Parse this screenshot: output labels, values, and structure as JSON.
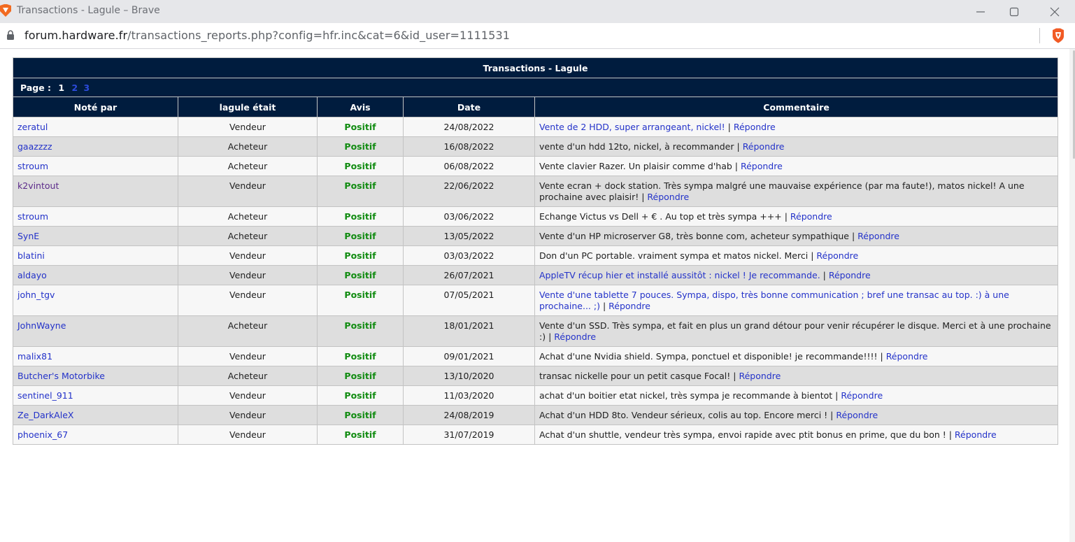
{
  "window": {
    "title": "Transactions - Lagule – Brave"
  },
  "address_bar": {
    "host": "forum.hardware.fr",
    "path": "/transactions_reports.php?config=hfr.inc&cat=6&id_user=1111531"
  },
  "table": {
    "caption": "Transactions - Lagule",
    "pagination": {
      "label": "Page :",
      "current": "1",
      "pages": [
        "2",
        "3"
      ]
    },
    "columns": [
      "Noté par",
      "lagule était",
      "Avis",
      "Date",
      "Commentaire"
    ],
    "reply_label": "Répondre",
    "separator": " | ",
    "rows": [
      {
        "user": "zeratul",
        "role": "Vendeur",
        "avis": "Positif",
        "date": "24/08/2022",
        "comment": "Vente de 2 HDD, super arrangeant, nickel!",
        "comment_is_link": true
      },
      {
        "user": "gaazzzz",
        "role": "Acheteur",
        "avis": "Positif",
        "date": "16/08/2022",
        "comment": "vente d'un hdd 12to, nickel, à recommander",
        "comment_is_link": false
      },
      {
        "user": "stroum",
        "role": "Acheteur",
        "avis": "Positif",
        "date": "06/08/2022",
        "comment": "Vente clavier Razer. Un plaisir comme d'hab",
        "comment_is_link": false
      },
      {
        "user": "k2vintout",
        "role": "Vendeur",
        "avis": "Positif",
        "date": "22/06/2022",
        "comment": "Vente ecran + dock station. Très sympa malgré une mauvaise expérience (par ma faute!), matos nickel! A une prochaine avec plaisir!",
        "comment_is_link": false,
        "visited": true
      },
      {
        "user": "stroum",
        "role": "Acheteur",
        "avis": "Positif",
        "date": "03/06/2022",
        "comment": "Echange Victus vs Dell + € . Au top et très sympa +++",
        "comment_is_link": false
      },
      {
        "user": "SynE",
        "role": "Acheteur",
        "avis": "Positif",
        "date": "13/05/2022",
        "comment": "Vente d'un HP microserver G8, très bonne com, acheteur sympathique",
        "comment_is_link": false
      },
      {
        "user": "blatini",
        "role": "Vendeur",
        "avis": "Positif",
        "date": "03/03/2022",
        "comment": "Don d'un PC portable. vraiment sympa et matos nickel. Merci",
        "comment_is_link": false
      },
      {
        "user": "aldayo",
        "role": "Vendeur",
        "avis": "Positif",
        "date": "26/07/2021",
        "comment": "AppleTV récup hier et installé aussitôt : nickel ! Je recommande.",
        "comment_is_link": true
      },
      {
        "user": "john_tgv",
        "role": "Vendeur",
        "avis": "Positif",
        "date": "07/05/2021",
        "comment": "Vente d'une tablette 7 pouces. Sympa, dispo, très bonne communication ; bref une transac au top. :) à une prochaine... ;)",
        "comment_is_link": true
      },
      {
        "user": "JohnWayne",
        "role": "Acheteur",
        "avis": "Positif",
        "date": "18/01/2021",
        "comment": "Vente d'un SSD. Très sympa, et fait en plus un grand détour pour venir récupérer le disque. Merci et à une prochaine :)",
        "comment_is_link": false
      },
      {
        "user": "malix81",
        "role": "Vendeur",
        "avis": "Positif",
        "date": "09/01/2021",
        "comment": "Achat d'une Nvidia shield. Sympa, ponctuel et disponible! je recommande!!!!",
        "comment_is_link": false
      },
      {
        "user": "Butcher's Motorbike",
        "role": "Acheteur",
        "avis": "Positif",
        "date": "13/10/2020",
        "comment": "transac nickelle pour un petit casque Focal!",
        "comment_is_link": false
      },
      {
        "user": "sentinel_911",
        "role": "Vendeur",
        "avis": "Positif",
        "date": "11/03/2020",
        "comment": "achat d'un boitier etat nickel, très sympa je recommande à bientot",
        "comment_is_link": false
      },
      {
        "user": "Ze_DarkAleX",
        "role": "Vendeur",
        "avis": "Positif",
        "date": "24/08/2019",
        "comment": "Achat d'un HDD 8to. Vendeur sérieux, colis au top. Encore merci !",
        "comment_is_link": false
      },
      {
        "user": "phoenix_67",
        "role": "Vendeur",
        "avis": "Positif",
        "date": "31/07/2019",
        "comment": "Achat d'un shuttle, vendeur très sympa, envoi rapide avec ptit bonus en prime, que du bon !",
        "comment_is_link": false
      }
    ]
  },
  "colors": {
    "header_bg": "#001c3e",
    "link": "#2332c9",
    "positive": "#128c12",
    "row_odd": "#f7f7f7",
    "row_even": "#dedede"
  },
  "icons": [
    "brave-logo-icon",
    "minimize-icon",
    "maximize-icon",
    "close-icon",
    "lock-icon",
    "brave-shield-icon"
  ]
}
